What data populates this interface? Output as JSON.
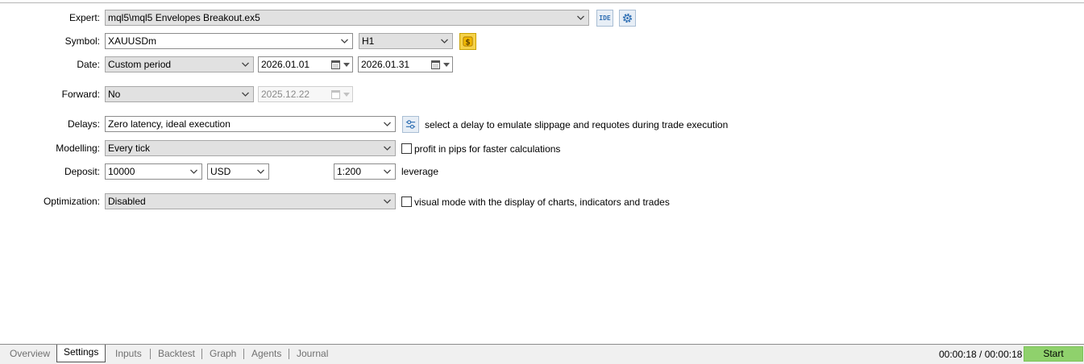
{
  "expert": {
    "label": "Expert:",
    "value": "mql5\\mql5 Envelopes Breakout.ex5",
    "ide_icon_text": "IDE",
    "icons": [
      "ide-icon",
      "gear-icon"
    ]
  },
  "symbol": {
    "label": "Symbol:",
    "value": "XAUUSDm",
    "timeframe": "H1",
    "icon": "dollar-coin-icon"
  },
  "date": {
    "label": "Date:",
    "mode": "Custom period",
    "from": "2026.01.01",
    "to": "2026.01.31"
  },
  "forward": {
    "label": "Forward:",
    "value": "No",
    "date": "2025.12.22"
  },
  "delays": {
    "label": "Delays:",
    "value": "Zero latency, ideal execution",
    "hint": "select a delay to emulate slippage and requotes during trade execution",
    "icon": "sliders-icon"
  },
  "modelling": {
    "label": "Modelling:",
    "value": "Every tick",
    "checkbox_label": "profit in pips for faster calculations",
    "checked": false
  },
  "deposit": {
    "label": "Deposit:",
    "amount": "10000",
    "currency": "USD",
    "leverage": "1:200",
    "leverage_label": "leverage"
  },
  "optimization": {
    "label": "Optimization:",
    "value": "Disabled",
    "checkbox_label": "visual mode with the display of charts, indicators and trades",
    "checked": false
  },
  "tabs": [
    "Overview",
    "Settings",
    "Inputs",
    "Backtest",
    "Graph",
    "Agents",
    "Journal"
  ],
  "active_tab": "Settings",
  "timer": "00:00:18 / 00:00:18",
  "start_label": "Start",
  "colors": {
    "start_button": "#8fd16c",
    "combo_bg": "#e1e1e1",
    "icon_blue": "#2f6fb3",
    "coin_gold": "#f2b900"
  }
}
